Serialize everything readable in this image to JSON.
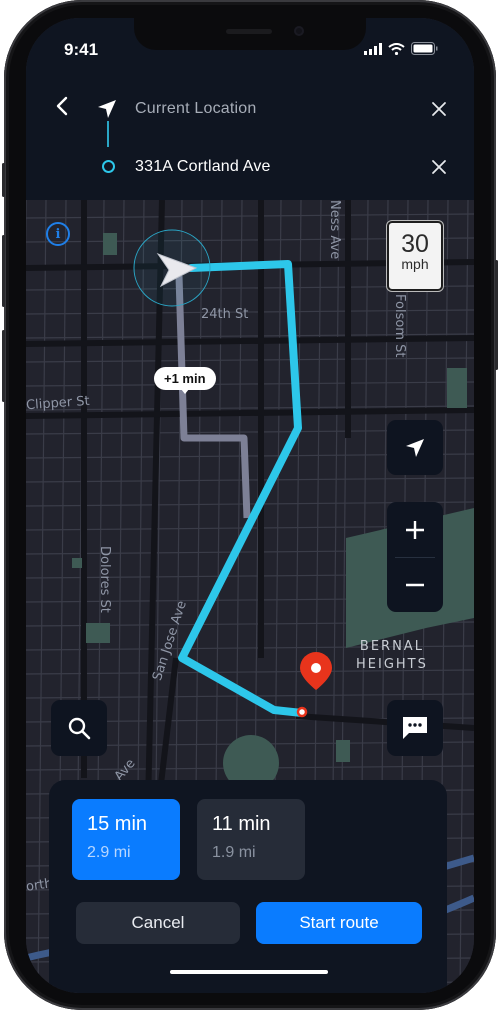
{
  "status_bar": {
    "time": "9:41",
    "icons": [
      "signal-icon",
      "wifi-icon",
      "battery-icon"
    ]
  },
  "header": {
    "back_icon": "chevron-left-icon",
    "origin": {
      "icon": "navigation-arrow-icon",
      "label": "Current Location",
      "clear_icon": "close-icon"
    },
    "destination": {
      "icon": "destination-ring-icon",
      "label": "331A Cortland Ave",
      "clear_icon": "close-icon"
    }
  },
  "map": {
    "info_icon": "info-icon",
    "info_glyph": "i",
    "speed_limit": {
      "value": "30",
      "unit": "mph"
    },
    "alt_route_delta": "+1 min",
    "street_labels": [
      "24th St",
      "Clipper St",
      "Dolores St",
      "San Jose Ave",
      "Jose Ave",
      "Ness Ave",
      "Folsom St",
      "orth"
    ],
    "area_label": [
      "BERNAL",
      "HEIGHTS"
    ],
    "controls": {
      "recenter_icon": "location-arrow-icon",
      "zoom_in": "+",
      "zoom_out": "−",
      "search_icon": "search-icon",
      "chat_icon": "chat-bubble-icon"
    },
    "colors": {
      "route_primary": "#2dc7ea",
      "route_alt": "#7d8096",
      "destination_pin": "#e8341c",
      "park": "#3e5a54"
    }
  },
  "routes": [
    {
      "time": "15 min",
      "distance": "2.9 mi",
      "selected": true
    },
    {
      "time": "11 min",
      "distance": "1.9 mi",
      "selected": false
    }
  ],
  "actions": {
    "cancel": "Cancel",
    "start": "Start route"
  },
  "colors": {
    "accent": "#0a7cff",
    "panel": "#0f1521",
    "secondary_button": "#262c38"
  }
}
